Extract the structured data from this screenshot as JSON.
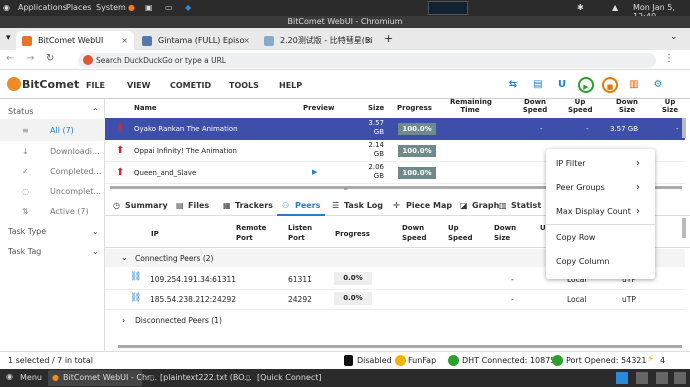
{
  "os_bar": {
    "applications": "Applications",
    "places": "Places",
    "system": "System",
    "clock": "Mon Jan 5, 12:40"
  },
  "window_title": "BitComet WebUI - Chromium",
  "tabs": [
    {
      "label": "BitComet WebUI"
    },
    {
      "label": "Gintama (FULL) Episo"
    },
    {
      "label": "2.20测试版 - 比特彗星(Bi"
    }
  ],
  "address": {
    "placeholder": "Search DuckDuckGo or type a URL"
  },
  "app": {
    "logo": "BitComet",
    "menus": [
      "FILE",
      "VIEW",
      "COMETID",
      "TOOLS",
      "HELP"
    ]
  },
  "sidebar": {
    "status_header": "Status",
    "items": [
      {
        "label": "All (7)"
      },
      {
        "label": "Downloadi..."
      },
      {
        "label": "Completed..."
      },
      {
        "label": "Uncomplet..."
      },
      {
        "label": "Active (7)"
      }
    ],
    "task_type": "Task Type",
    "task_tag": "Task Tag"
  },
  "grid": {
    "headers": {
      "name": "Name",
      "preview": "Preview",
      "size": "Size",
      "progress": "Progress",
      "remaining": "Remaining Time",
      "down_speed": "Down Speed",
      "up_speed": "Up Speed",
      "down_size": "Down Size",
      "up_size": "Up Size"
    },
    "rows": [
      {
        "name": "Oyako Rankan The Animation",
        "size": "3.57 GB",
        "progress": "100.0%",
        "down_speed": "-",
        "up_speed": "-",
        "down_size": "3.57 GB",
        "up_size": "-"
      },
      {
        "name": "Oppai Infinity! The Animation",
        "size": "2.14 GB",
        "progress": "100.0%"
      },
      {
        "name": "Queen_and_Slave",
        "size": "2.06 GB",
        "progress": "100.0%"
      }
    ]
  },
  "detail_tabs": [
    "Summary",
    "Files",
    "Trackers",
    "Peers",
    "Task Log",
    "Piece Map",
    "Graph",
    "Statist"
  ],
  "peers": {
    "headers": {
      "ip": "IP",
      "remote_port": "Remote Port",
      "listen_port": "Listen Port",
      "progress": "Progress",
      "down_speed": "Down Speed",
      "up_speed": "Up Speed",
      "down_size": "Down Size",
      "up": "U"
    },
    "connecting_group": "Connecting Peers (2)",
    "rows": [
      {
        "ip": "109.254.191.34:61311",
        "listen_port": "61311",
        "progress": "0.0%",
        "down_size": "-",
        "type": "Local",
        "proto": "uTP"
      },
      {
        "ip": "185.54.238.212:24292",
        "listen_port": "24292",
        "progress": "0.0%",
        "down_size": "-",
        "type": "Local",
        "proto": "uTP"
      }
    ],
    "disconnected_group": "Disconnected Peers (1)"
  },
  "context_menu": [
    "IP Filter",
    "Peer Groups",
    "Max Display Count",
    "Copy Row",
    "Copy Column"
  ],
  "status": {
    "selection": "1 selected / 7 in total",
    "disabled": "Disabled",
    "funfap": "FunFap",
    "dht": "DHT Connected: 10875",
    "port": "Port Opened: 54321",
    "warnings": "4"
  },
  "taskbar": {
    "menu": "Menu",
    "items": [
      "BitComet WebUI - Chr...",
      "[plaintext222.txt (BO...",
      "[Quick Connect]"
    ]
  },
  "colors": {
    "selected_row": "#3d4fa8",
    "progress_bar": "#6f8a8a",
    "accent": "#1f7fd0"
  }
}
